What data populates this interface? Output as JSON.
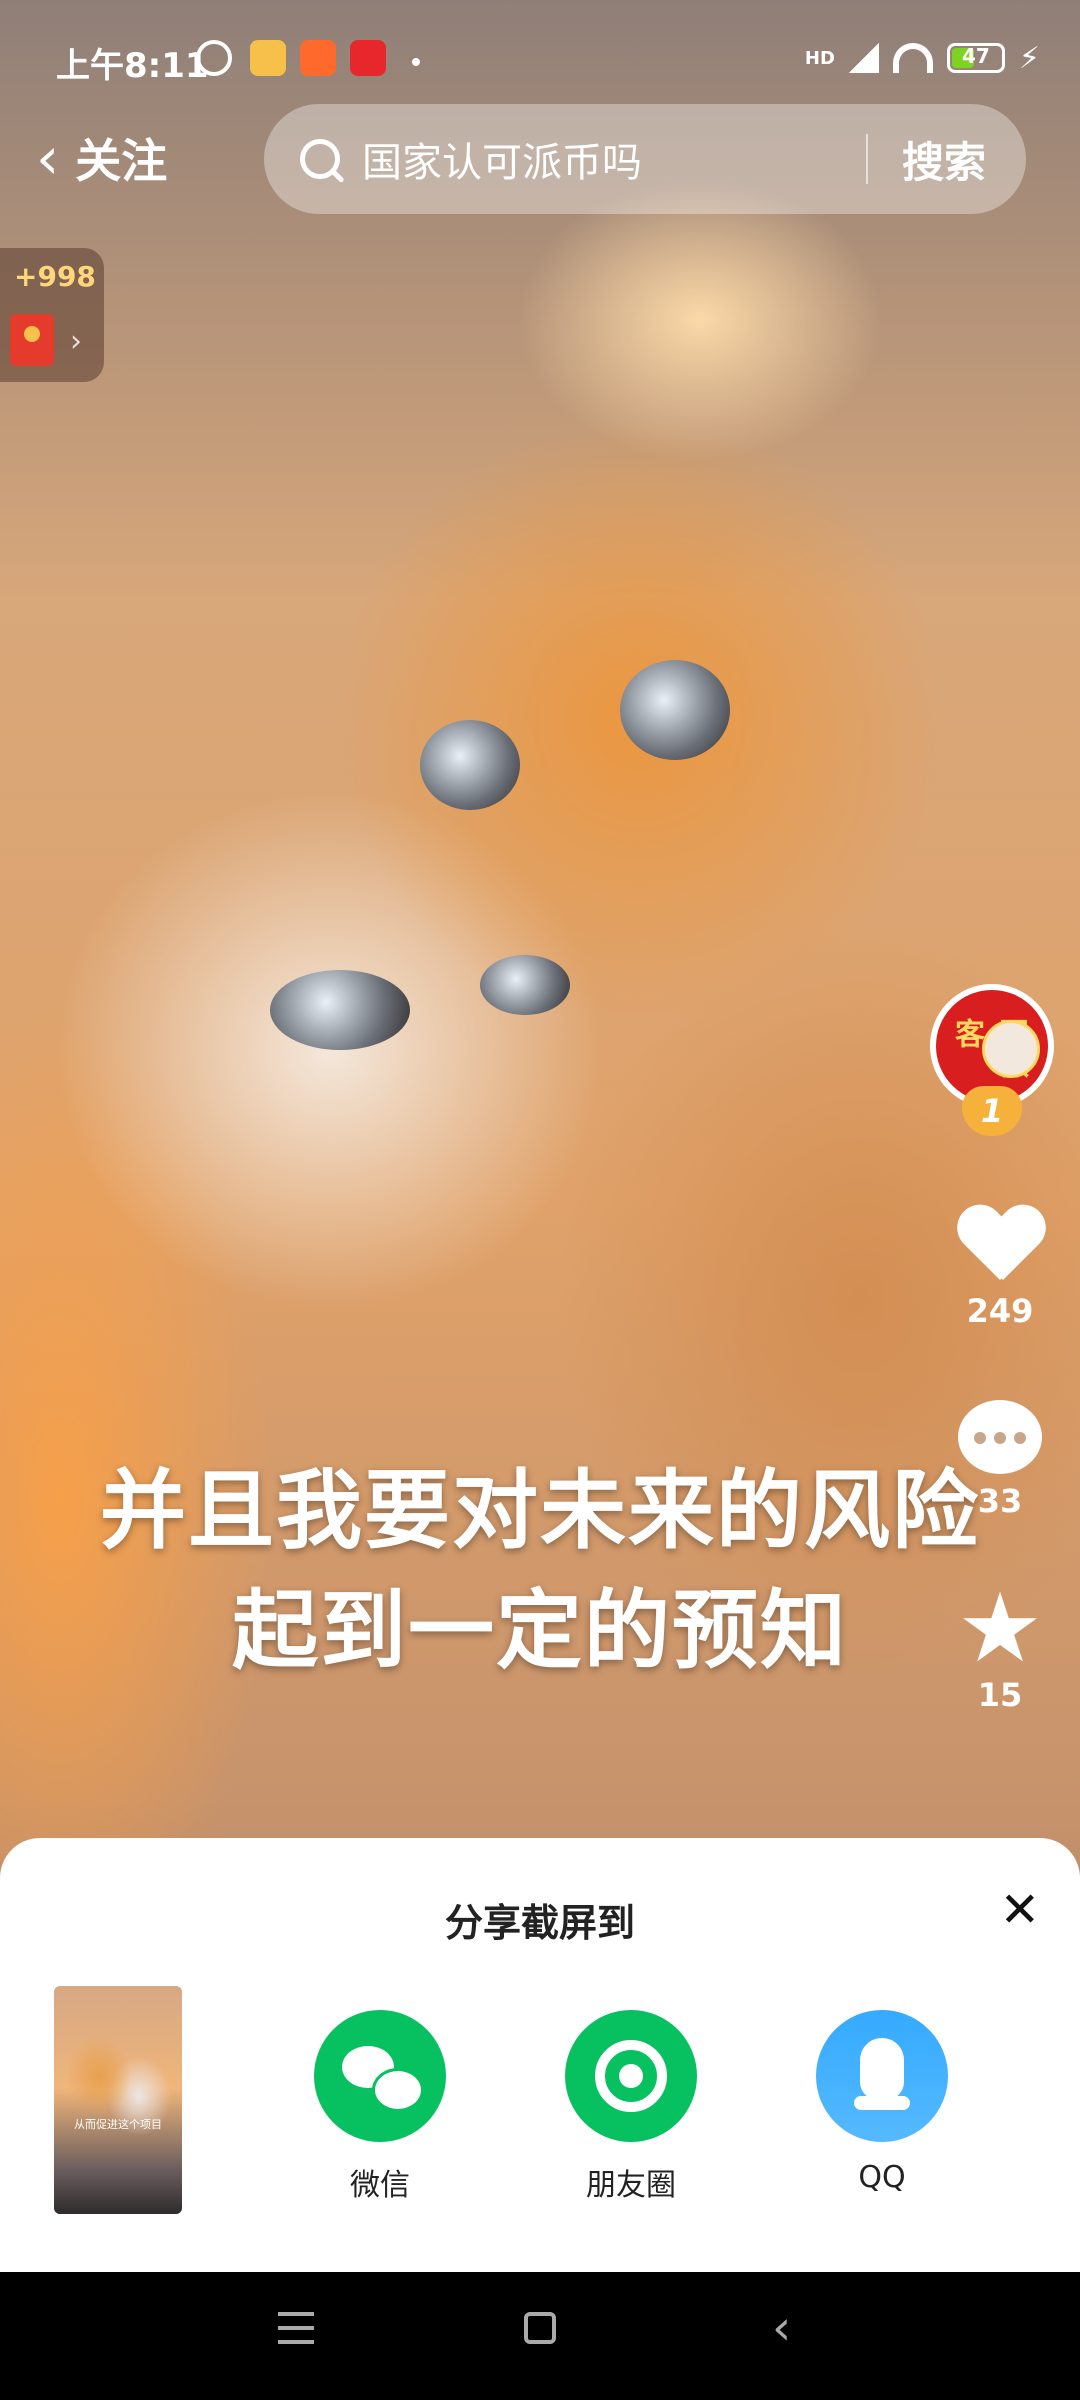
{
  "status": {
    "time": "上午8:11",
    "battery": "47",
    "battery_level_pct": 47,
    "signal_label": "HD",
    "icons": [
      "alarm-icon",
      "app-icon-1",
      "app-icon-2",
      "app-icon-3",
      "signal-icon",
      "wifi-icon",
      "battery-icon",
      "charging-icon"
    ]
  },
  "header": {
    "back_label": "关注",
    "search_query": "国家认可派币吗",
    "search_button": "搜索"
  },
  "reward": {
    "amount": "+998"
  },
  "video": {
    "caption_line1": "并且我要对未来的风险",
    "caption_line2": "起到一定的预知"
  },
  "actions": {
    "avatar_text": "国微客",
    "badge": "1",
    "likes": "249",
    "comments": "33",
    "favorites": "15"
  },
  "share_sheet": {
    "title": "分享截屏到",
    "targets": [
      {
        "label": "微信",
        "color": "#07c160"
      },
      {
        "label": "朋友圈",
        "color": "#07c160"
      },
      {
        "label": "QQ",
        "color": "#3aa8ff"
      }
    ],
    "thumbnail_caption": "从而促进这个项目"
  }
}
